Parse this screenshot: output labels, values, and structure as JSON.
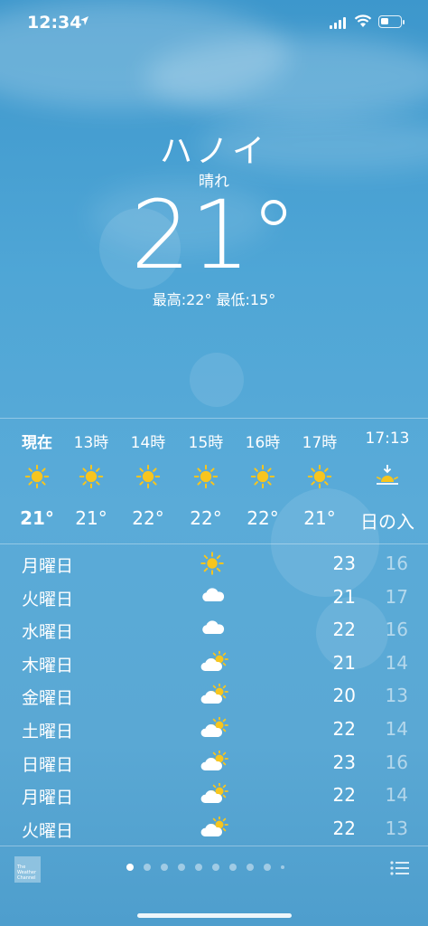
{
  "status_bar": {
    "time": "12:34"
  },
  "header": {
    "city": "ハノイ",
    "condition": "晴れ",
    "temperature": "21°",
    "hi_lo": "最高:22° 最低:15°"
  },
  "hourly": [
    {
      "label": "現在",
      "icon": "sun-icon",
      "temp": "21°",
      "bold": true
    },
    {
      "label": "13時",
      "icon": "sun-icon",
      "temp": "21°"
    },
    {
      "label": "14時",
      "icon": "sun-icon",
      "temp": "22°"
    },
    {
      "label": "15時",
      "icon": "sun-icon",
      "temp": "22°"
    },
    {
      "label": "16時",
      "icon": "sun-icon",
      "temp": "22°"
    },
    {
      "label": "17時",
      "icon": "sun-icon",
      "temp": "21°"
    },
    {
      "label": "17:13",
      "icon": "sunset-icon",
      "temp": "日の入"
    }
  ],
  "daily": [
    {
      "day": "月曜日",
      "icon": "sun-icon",
      "high": "23",
      "low": "16"
    },
    {
      "day": "火曜日",
      "icon": "cloud-icon",
      "high": "21",
      "low": "17"
    },
    {
      "day": "水曜日",
      "icon": "cloud-icon",
      "high": "22",
      "low": "16"
    },
    {
      "day": "木曜日",
      "icon": "partly-cloudy-icon",
      "high": "21",
      "low": "14"
    },
    {
      "day": "金曜日",
      "icon": "partly-cloudy-icon",
      "high": "20",
      "low": "13"
    },
    {
      "day": "土曜日",
      "icon": "partly-cloudy-icon",
      "high": "22",
      "low": "14"
    },
    {
      "day": "日曜日",
      "icon": "partly-cloudy-icon",
      "high": "23",
      "low": "16"
    },
    {
      "day": "月曜日",
      "icon": "partly-cloudy-icon",
      "high": "22",
      "low": "14"
    },
    {
      "day": "火曜日",
      "icon": "partly-cloudy-icon",
      "high": "22",
      "low": "13"
    }
  ],
  "footer": {
    "logo_text": "The Weather Channel",
    "page_count": 10,
    "active_page": 0
  },
  "colors": {
    "sun": "#f7c51e",
    "background": "#4fa6d6"
  }
}
